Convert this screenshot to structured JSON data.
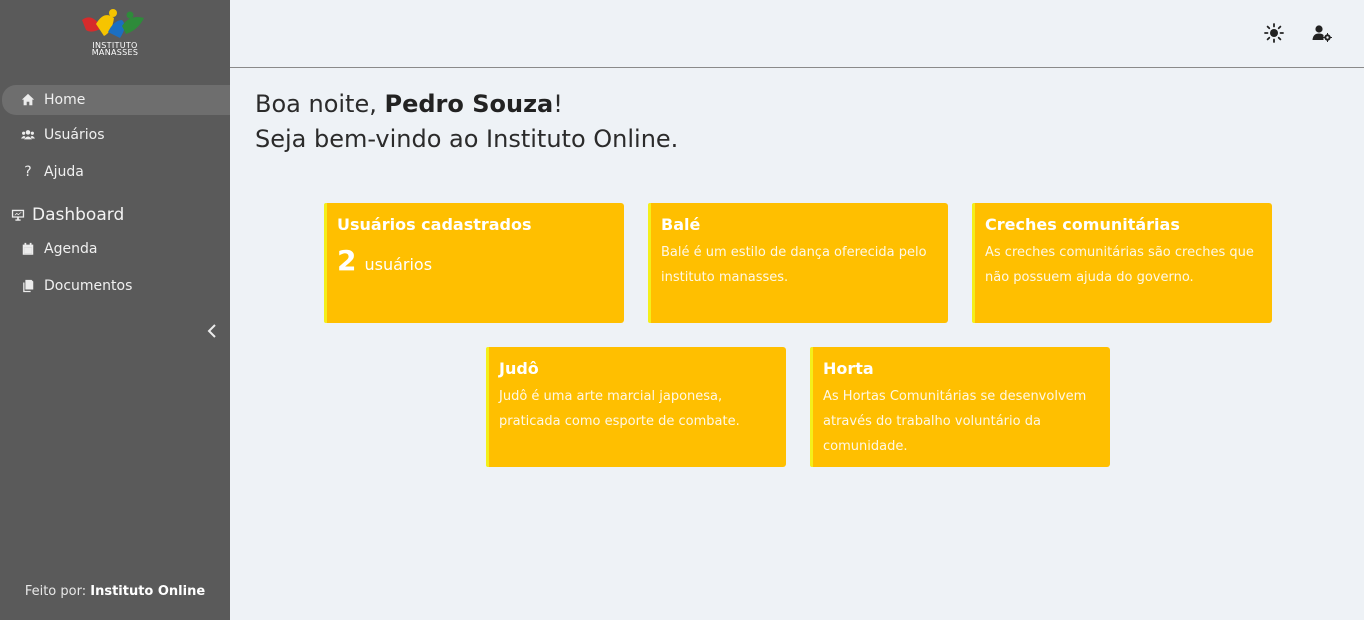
{
  "sidebar": {
    "logo": {
      "line1": "INSTITUTO",
      "line2": "MANASSES",
      "colors": [
        "#d62b2b",
        "#f6c400",
        "#1b6fc2",
        "#2e8b3a"
      ]
    },
    "items": [
      {
        "label": "Home",
        "icon": "home-icon",
        "active": true
      },
      {
        "label": "Usuários",
        "icon": "users-icon"
      },
      {
        "label": "Ajuda",
        "icon": "question-icon"
      }
    ],
    "section": {
      "label": "Dashboard",
      "icon": "dashboard-icon"
    },
    "section_items": [
      {
        "label": "Agenda",
        "icon": "calendar-icon"
      },
      {
        "label": "Documentos",
        "icon": "documents-icon"
      }
    ],
    "footer": {
      "prefix": "Feito por:",
      "brand": "Instituto Online"
    }
  },
  "header": {
    "icons": [
      "theme-toggle-icon",
      "user-settings-icon"
    ]
  },
  "greeting": {
    "prefix": "Boa noite, ",
    "name": "Pedro Souza",
    "suffix": "!",
    "welcome": "Seja bem-vindo ao Instituto Online."
  },
  "cards": [
    {
      "title": "Usuários cadastrados",
      "count": "2",
      "unit": "usuários"
    },
    {
      "title": "Balé",
      "text": "Balé é um estilo de dança oferecida pelo instituto manasses."
    },
    {
      "title": "Creches comunitárias",
      "text": "As creches comunitárias são creches que não possuem ajuda do governo."
    },
    {
      "title": "Judô",
      "text": "Judô é uma arte marcial japonesa, praticada como esporte de combate."
    },
    {
      "title": "Horta",
      "text": "As Hortas Comunitárias se desenvolvem através do trabalho voluntário da comunidade."
    }
  ],
  "colors": {
    "sidebar": "#5a5a5a",
    "card": "#ffbf00",
    "card_border": "#f4ef1a",
    "background": "#eef2f6"
  }
}
